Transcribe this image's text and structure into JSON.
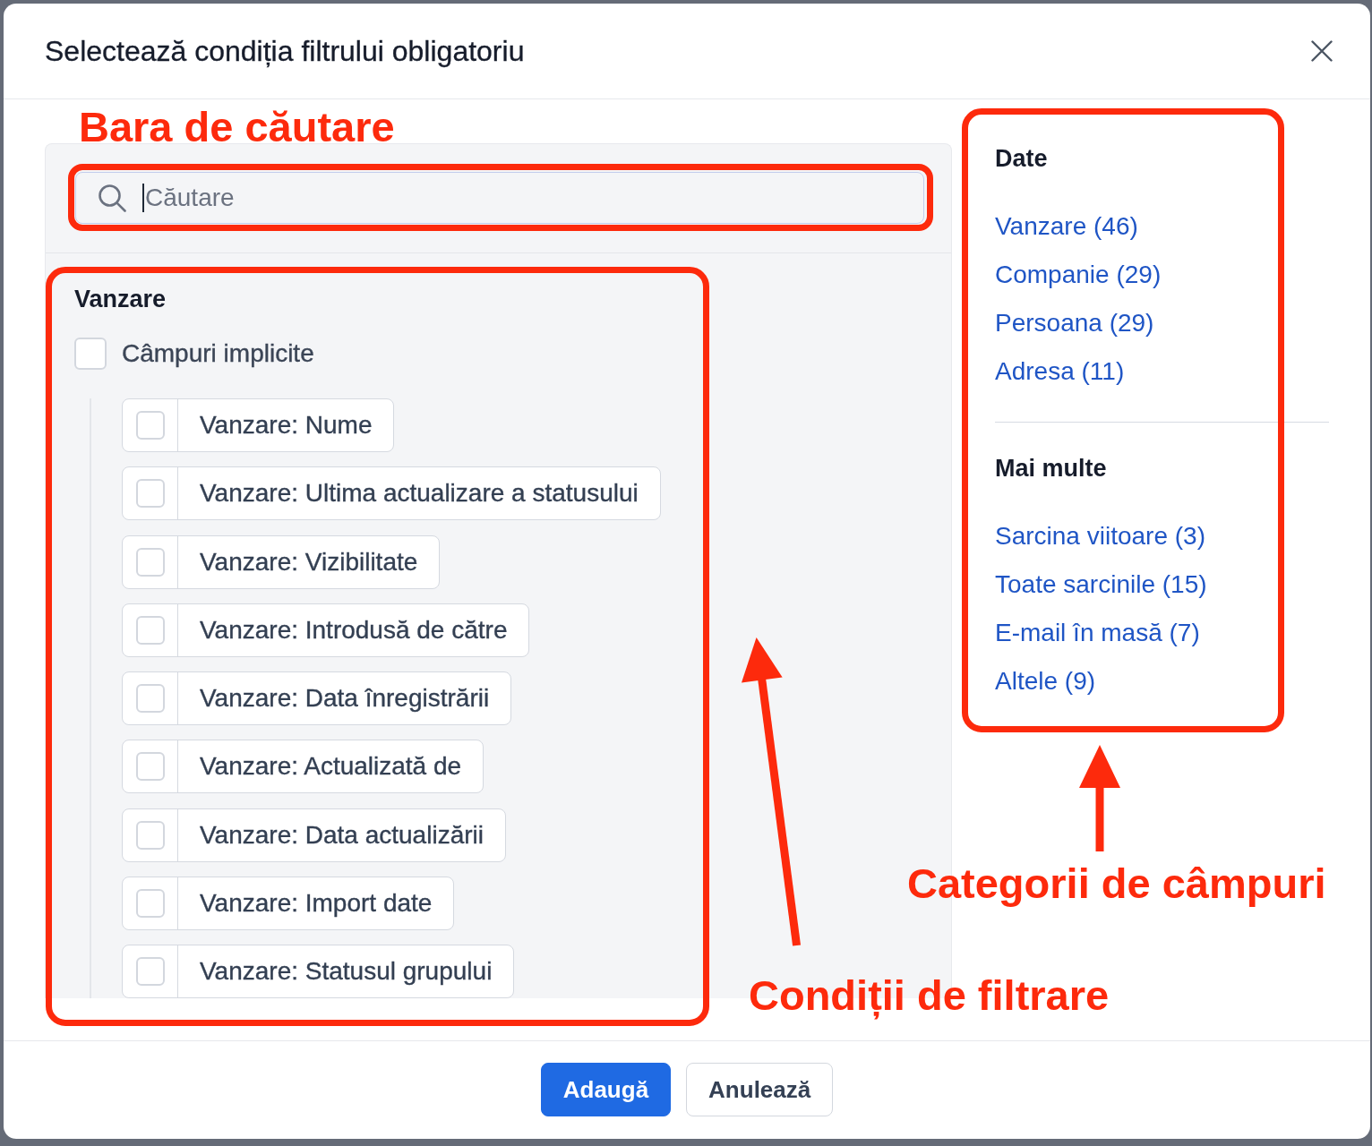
{
  "dialog": {
    "title": "Selectează condiția filtrului obligatoriu"
  },
  "search": {
    "placeholder": "Căutare",
    "focused": true
  },
  "field_list": {
    "heading": "Vanzare",
    "select_all": {
      "label": "Câmpuri implicite",
      "checked": false
    },
    "items": [
      {
        "label": "Vanzare: Nume",
        "checked": false
      },
      {
        "label": "Vanzare: Ultima actualizare a statusului",
        "checked": false
      },
      {
        "label": "Vanzare: Vizibilitate",
        "checked": false
      },
      {
        "label": "Vanzare: Introdusă de către",
        "checked": false
      },
      {
        "label": "Vanzare: Data înregistrării",
        "checked": false
      },
      {
        "label": "Vanzare: Actualizată de",
        "checked": false
      },
      {
        "label": "Vanzare: Data actualizării",
        "checked": false
      },
      {
        "label": "Vanzare: Import date",
        "checked": false
      },
      {
        "label": "Vanzare: Statusul grupului",
        "checked": false
      }
    ]
  },
  "categories": [
    {
      "heading": "Date",
      "items": [
        "Vanzare (46)",
        "Companie (29)",
        "Persoana (29)",
        "Adresa (11)"
      ]
    },
    {
      "heading": "Mai multe",
      "items": [
        "Sarcina viitoare (3)",
        "Toate sarcinile (15)",
        "E-mail în masă (7)",
        "Altele (9)"
      ]
    }
  ],
  "buttons": [
    {
      "label": "Adaugă",
      "kind": "primary"
    },
    {
      "label": "Anulează",
      "kind": "secondary"
    }
  ],
  "annotations": [
    {
      "label": "Bara de căutare",
      "arrow": false
    },
    {
      "label": "Categorii de câmpuri",
      "arrow": true
    },
    {
      "label": "Condiții de filtrare",
      "arrow": true
    }
  ]
}
